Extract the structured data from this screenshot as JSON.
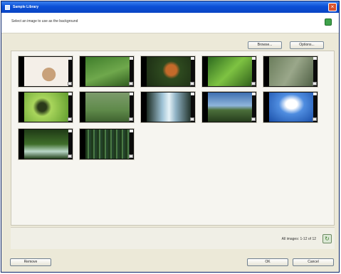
{
  "window": {
    "title": "Sample Library",
    "instruction": "Select an image to use as the background"
  },
  "toolbar": {
    "button_1_label": "Browse...",
    "button_2_label": "Options..."
  },
  "thumbnails": [
    {
      "subject": "cat on white"
    },
    {
      "subject": "deer in grass"
    },
    {
      "subject": "fox"
    },
    {
      "subject": "bird on leaf"
    },
    {
      "subject": "bird on branch"
    },
    {
      "subject": "bird on twig"
    },
    {
      "subject": "deer in meadow"
    },
    {
      "subject": "waterfall"
    },
    {
      "subject": "mountain landscape"
    },
    {
      "subject": "blue sky clouds"
    },
    {
      "subject": "forest stream"
    },
    {
      "subject": "bamboo forest"
    }
  ],
  "status": {
    "left_text": "",
    "page_info": "All images: 1-12 of 12"
  },
  "footer": {
    "left_button": "Remove",
    "ok_button": "OK",
    "cancel_button": "Cancel"
  },
  "colors": {
    "titlebar": "#0a4fd6",
    "window_bg": "#ece9d8",
    "panel_bg": "#f6f5f0"
  },
  "icons": {
    "title": "app-icon",
    "close": "close-icon",
    "help": "help-icon",
    "refresh": "refresh-icon"
  }
}
